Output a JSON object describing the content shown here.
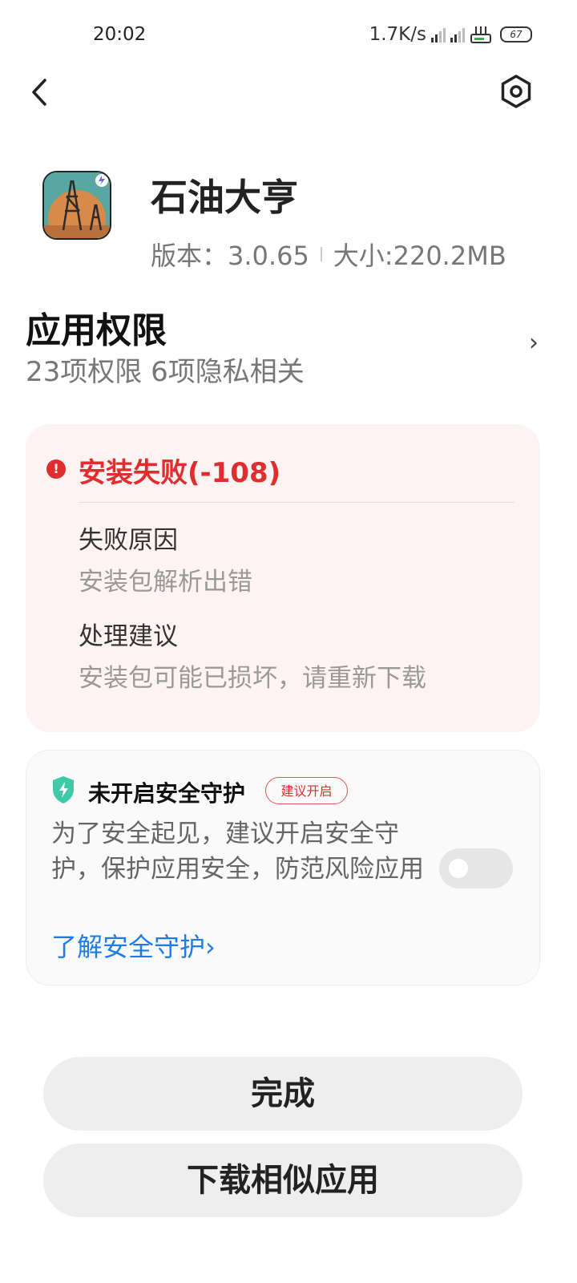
{
  "status_bar": {
    "time": "20:02",
    "network_speed": "1.7K/s",
    "battery": "67"
  },
  "app": {
    "name": "石油大亨",
    "version_label": "版本：",
    "version": "3.0.65",
    "size_label": "大小:",
    "size": "220.2MB"
  },
  "permissions": {
    "title": "应用权限",
    "summary": "23项权限 6项隐私相关",
    "chevron": "›"
  },
  "error": {
    "title": "安装失败(-108)",
    "reason_label": "失败原因",
    "reason_value": "安装包解析出错",
    "suggestion_label": "处理建议",
    "suggestion_value": "安装包可能已损坏，请重新下载",
    "color": "#e02d2d"
  },
  "security": {
    "title": "未开启安全守护",
    "badge": "建议开启",
    "description": "为了安全起见，建议开启安全守护，保护应用安全，防范风险应用",
    "link": "了解安全守护›",
    "toggle_on": false,
    "link_color": "#1e7ce8"
  },
  "buttons": {
    "done": "完成",
    "similar": "下载相似应用"
  }
}
